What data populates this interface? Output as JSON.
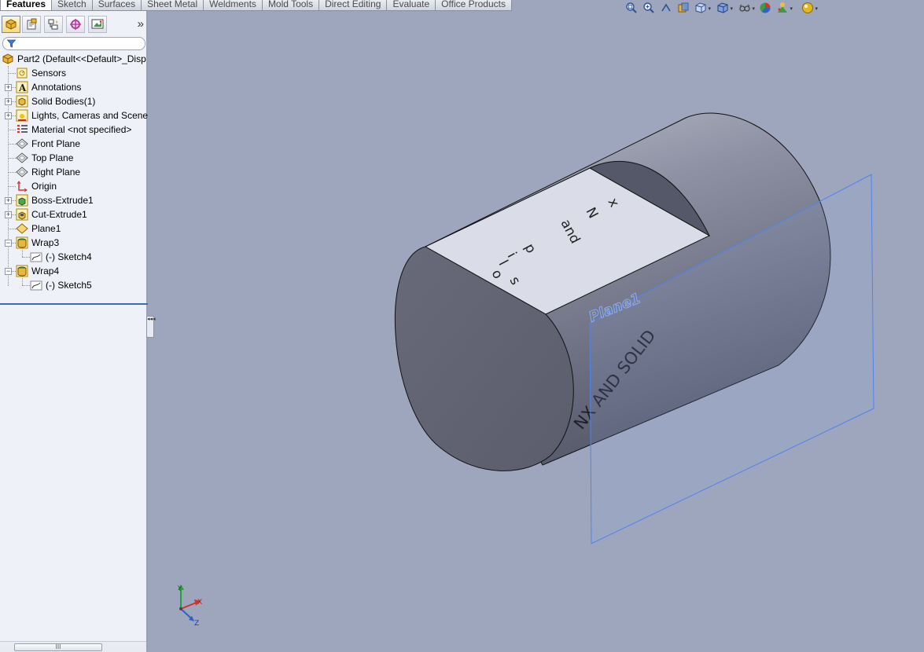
{
  "tabs": [
    {
      "label": "Features",
      "active": true
    },
    {
      "label": "Sketch"
    },
    {
      "label": "Surfaces"
    },
    {
      "label": "Sheet Metal"
    },
    {
      "label": "Weldments"
    },
    {
      "label": "Mold Tools"
    },
    {
      "label": "Direct Editing"
    },
    {
      "label": "Evaluate"
    },
    {
      "label": "Office Products"
    }
  ],
  "panel": {
    "toolbar_icons": [
      "feature-manager-icon",
      "property-manager-icon",
      "configuration-manager-icon",
      "dimxpert-manager-icon",
      "display-manager-icon"
    ],
    "expand_glyph": "»",
    "filter_icon": "filter-icon"
  },
  "tree": {
    "root": "Part2  (Default<<Default>_Disp",
    "items": [
      {
        "label": "Sensors",
        "icon": "sensors-icon",
        "expander": false
      },
      {
        "label": "Annotations",
        "icon": "annotations-icon",
        "expander": "+"
      },
      {
        "label": "Solid Bodies(1)",
        "icon": "solid-bodies-icon",
        "expander": "+"
      },
      {
        "label": "Lights, Cameras and Scene",
        "icon": "lights-cameras-icon",
        "expander": "+"
      },
      {
        "label": "Material <not specified>",
        "icon": "material-icon",
        "expander": false
      },
      {
        "label": "Front Plane",
        "icon": "plane-icon",
        "expander": false
      },
      {
        "label": "Top Plane",
        "icon": "plane-icon",
        "expander": false
      },
      {
        "label": "Right Plane",
        "icon": "plane-icon",
        "expander": false
      },
      {
        "label": "Origin",
        "icon": "origin-icon",
        "expander": false
      },
      {
        "label": "Boss-Extrude1",
        "icon": "boss-extrude-icon",
        "expander": "+"
      },
      {
        "label": "Cut-Extrude1",
        "icon": "cut-extrude-icon",
        "expander": "+"
      },
      {
        "label": "Plane1",
        "icon": "reference-plane-icon",
        "expander": false
      },
      {
        "label": "Wrap3",
        "icon": "wrap-icon",
        "expander": "-"
      },
      {
        "label": "(-) Sketch4",
        "icon": "sketch-icon",
        "child": true
      },
      {
        "label": "Wrap4",
        "icon": "wrap-icon",
        "expander": "-"
      },
      {
        "label": "(-) Sketch5",
        "icon": "sketch-icon",
        "child": true
      }
    ]
  },
  "scrollbar": {
    "grip": "III"
  },
  "splitter_glyph": "◂◂◂",
  "hud": {
    "buttons": [
      "zoom-to-fit-icon",
      "zoom-to-area-icon",
      "previous-view-icon",
      "section-view-icon",
      "view-orientation-icon",
      "display-style-icon",
      "hide-show-items-icon",
      "edit-appearance-icon",
      "apply-scene-icon",
      "view-settings-icon"
    ]
  },
  "viewport": {
    "plane_label": "Plane1",
    "wrapped_text_side": "NX AND SOLID",
    "flat_text": [
      "x",
      "N",
      "and",
      "p",
      "i",
      "l",
      "o",
      "s"
    ],
    "triad": {
      "x": "X",
      "y": "Y",
      "z": "Z"
    },
    "colors": {
      "background": "#9ea6bd",
      "cylinder_side_light": "#9ca1b1",
      "cylinder_side_dark": "#5d6070",
      "cylinder_end": "#636576",
      "flat_face": "#dadde7",
      "plane_edge": "#4f84ef"
    }
  }
}
